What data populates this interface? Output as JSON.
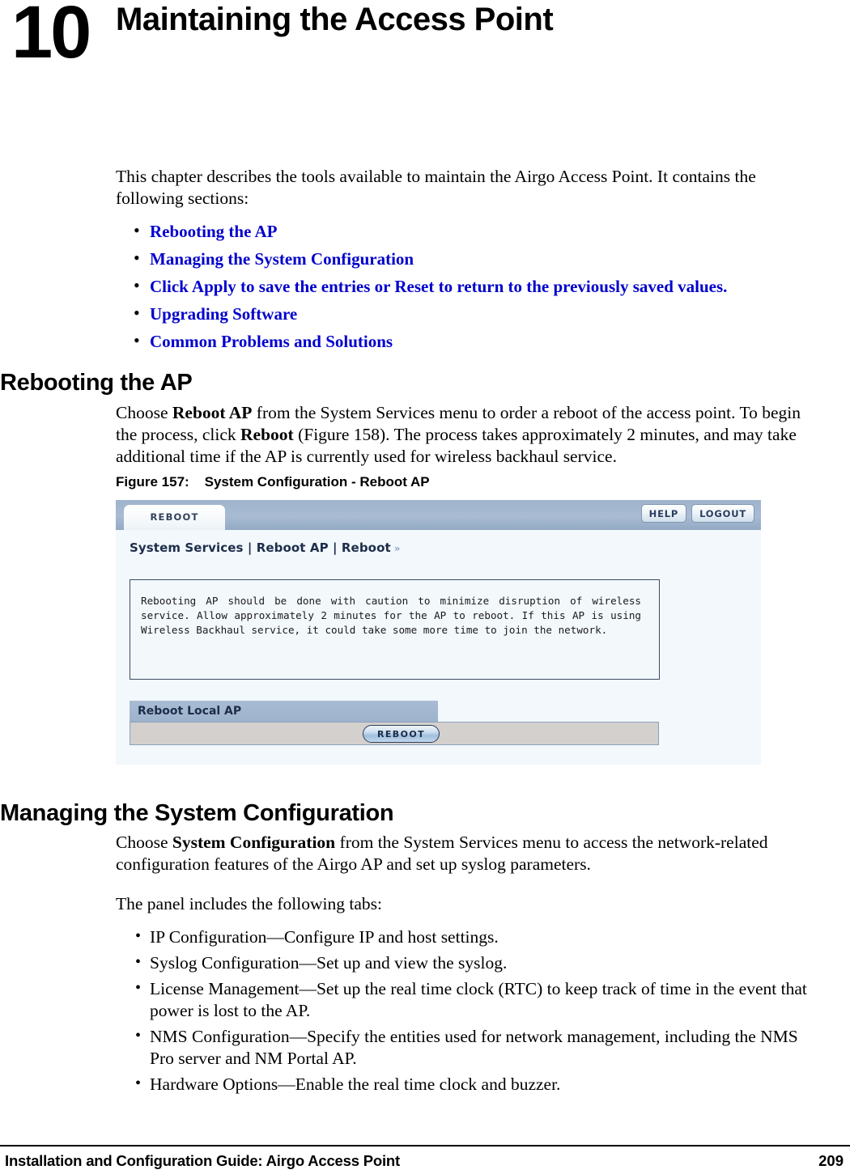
{
  "chapter": {
    "number": "10",
    "title": "Maintaining the Access Point"
  },
  "intro": {
    "paragraph": "This chapter describes the tools available to maintain the Airgo Access Point. It contains the following sections:",
    "links": [
      "Rebooting the AP",
      "Managing the System Configuration",
      "Click Apply to save the entries or Reset to return to the previously saved values.",
      "Upgrading Software",
      "Common Problems and Solutions"
    ],
    "link_color": "#0000CC"
  },
  "sections": {
    "rebooting": {
      "heading": "Rebooting the AP",
      "para_part1": "Choose ",
      "para_bold1": "Reboot AP",
      "para_part2": " from the System Services menu to order a reboot of the access point. To begin the process, click ",
      "para_bold2": "Reboot",
      "para_part3": " (Figure 158). The process takes approximately 2 minutes, and may take additional time if the AP is currently used for wireless backhaul service."
    },
    "managing": {
      "heading": "Managing the System Configuration",
      "para_part1": "Choose ",
      "para_bold1": "System Configuration",
      "para_part2": " from the System Services menu to access the network-related configuration features of the Airgo AP and set up syslog parameters.",
      "tabs_intro": "The panel includes the following tabs:",
      "tabs": [
        "IP Configuration—Configure IP and host settings.",
        "Syslog Configuration—Set up and view the syslog.",
        "License Management—Set up the real time clock (RTC) to keep track of time in the event that power is lost to the AP.",
        "NMS Configuration—Specify the entities used for network management, including the NMS Pro server and NM Portal AP.",
        "Hardware Options—Enable the real time clock and buzzer."
      ]
    }
  },
  "figure": {
    "caption_label": "Figure 157:",
    "caption_text": "System Configuration - Reboot AP",
    "screenshot": {
      "tab_label": "REBOOT",
      "help_label": "HELP",
      "logout_label": "LOGOUT",
      "breadcrumb": "System Services | Reboot AP | Reboot",
      "breadcrumb_chevron": "»",
      "note_text": "Rebooting AP should be done with caution to minimize disruption of wireless service. Allow approximately 2 minutes for the AP to reboot. If this AP is using Wireless Backhaul service, it could take some more time to join the network.",
      "section_bar_label": "Reboot Local AP",
      "reboot_button_label": "REBOOT",
      "colors": {
        "topbar": "#a3b7d0",
        "panel_bg": "#f2f8fb",
        "section_bar": "#a3b7d0",
        "action_row": "#d4d0cd",
        "text_dark": "#1d2d4a"
      }
    }
  },
  "footer": {
    "title": "Installation and Configuration Guide: Airgo Access Point",
    "page": "209"
  }
}
